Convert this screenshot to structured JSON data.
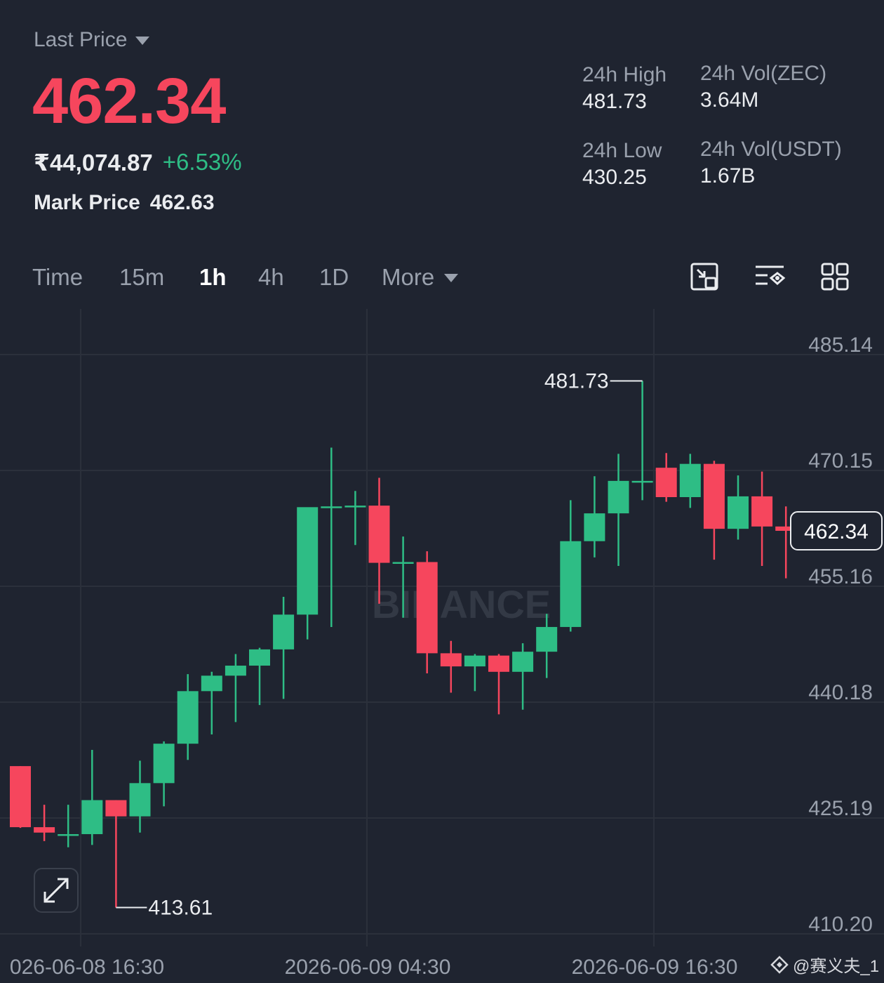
{
  "header": {
    "last_price_label": "Last Price",
    "last_price": "462.34",
    "fiat_price": "₹44,074.87",
    "change_pct": "+6.53%",
    "mark_price_label": "Mark Price",
    "mark_price": "462.63",
    "stats": {
      "high_label": "24h High",
      "high_value": "481.73",
      "low_label": "24h Low",
      "low_value": "430.25",
      "vol_base_label": "24h Vol(ZEC)",
      "vol_base_value": "3.64M",
      "vol_quote_label": "24h Vol(USDT)",
      "vol_quote_value": "1.67B"
    },
    "colors": {
      "up": "#2ebd85",
      "down": "#f6465d",
      "background": "#1f2430"
    }
  },
  "tabs": {
    "items": [
      "Time",
      "15m",
      "1h",
      "4h",
      "1D",
      "More"
    ],
    "active": "1h"
  },
  "toolbar": {
    "icons": [
      "chart-window-icon",
      "indicator-settings-icon",
      "grid-layout-icon"
    ]
  },
  "chart": {
    "watermark": "BINANCE",
    "current_price_tag": "462.34",
    "high_marker": "481.73",
    "low_marker": "413.61",
    "credit": "@赛义夫_1"
  },
  "chart_data": {
    "type": "candlestick",
    "interval": "1h",
    "y_ticks": [
      "485.14",
      "470.15",
      "455.16",
      "440.18",
      "425.19",
      "410.20"
    ],
    "x_ticks": [
      "026-06-08 16:30",
      "2026-06-09 04:30",
      "2026-06-09 16:30"
    ],
    "ylim": [
      410.2,
      485.14
    ],
    "grid": true,
    "last_price": 462.34,
    "max_high": 481.73,
    "min_low": 413.61,
    "candles": [
      {
        "o": 431.9,
        "h": 431.9,
        "l": 423.9,
        "c": 424.0
      },
      {
        "o": 424.0,
        "h": 426.9,
        "l": 422.2,
        "c": 423.3
      },
      {
        "o": 423.1,
        "h": 426.9,
        "l": 421.4,
        "c": 423.1
      },
      {
        "o": 423.1,
        "h": 434.0,
        "l": 421.7,
        "c": 427.5
      },
      {
        "o": 427.5,
        "h": 427.5,
        "l": 413.61,
        "c": 425.4
      },
      {
        "o": 425.4,
        "h": 432.6,
        "l": 423.3,
        "c": 429.7
      },
      {
        "o": 429.7,
        "h": 435.1,
        "l": 426.7,
        "c": 434.8
      },
      {
        "o": 434.8,
        "h": 443.8,
        "l": 432.7,
        "c": 441.6
      },
      {
        "o": 441.6,
        "h": 444.1,
        "l": 436.0,
        "c": 443.6
      },
      {
        "o": 443.6,
        "h": 446.4,
        "l": 437.6,
        "c": 444.9
      },
      {
        "o": 444.9,
        "h": 447.2,
        "l": 439.8,
        "c": 447.0
      },
      {
        "o": 447.0,
        "h": 453.8,
        "l": 440.6,
        "c": 451.5
      },
      {
        "o": 451.5,
        "h": 460.1,
        "l": 448.3,
        "c": 465.4
      },
      {
        "o": 465.4,
        "h": 473.1,
        "l": 449.9,
        "c": 465.5
      },
      {
        "o": 465.5,
        "h": 467.5,
        "l": 460.5,
        "c": 465.6
      },
      {
        "o": 465.6,
        "h": 469.2,
        "l": 452.9,
        "c": 458.2
      },
      {
        "o": 458.2,
        "h": 461.6,
        "l": 451.1,
        "c": 458.3
      },
      {
        "o": 458.3,
        "h": 459.7,
        "l": 443.9,
        "c": 446.5
      },
      {
        "o": 446.5,
        "h": 448.1,
        "l": 441.4,
        "c": 444.8
      },
      {
        "o": 444.8,
        "h": 446.4,
        "l": 441.6,
        "c": 446.2
      },
      {
        "o": 446.2,
        "h": 446.4,
        "l": 438.6,
        "c": 444.1
      },
      {
        "o": 444.1,
        "h": 447.8,
        "l": 439.2,
        "c": 446.7
      },
      {
        "o": 446.7,
        "h": 451.6,
        "l": 443.3,
        "c": 449.9
      },
      {
        "o": 449.9,
        "h": 466.3,
        "l": 449.3,
        "c": 461.0
      },
      {
        "o": 461.0,
        "h": 469.4,
        "l": 458.9,
        "c": 464.6
      },
      {
        "o": 464.6,
        "h": 472.3,
        "l": 457.8,
        "c": 468.8
      },
      {
        "o": 468.8,
        "h": 481.73,
        "l": 466.3,
        "c": 468.8
      },
      {
        "o": 470.5,
        "h": 472.4,
        "l": 466.1,
        "c": 466.7
      },
      {
        "o": 466.7,
        "h": 472.3,
        "l": 465.3,
        "c": 471.0
      },
      {
        "o": 471.0,
        "h": 471.4,
        "l": 458.6,
        "c": 462.6
      },
      {
        "o": 462.6,
        "h": 469.5,
        "l": 461.2,
        "c": 466.8
      },
      {
        "o": 466.8,
        "h": 470.0,
        "l": 457.8,
        "c": 462.9
      },
      {
        "o": 462.9,
        "h": 465.5,
        "l": 456.2,
        "c": 462.34
      }
    ]
  }
}
